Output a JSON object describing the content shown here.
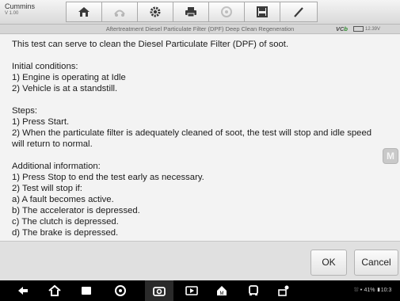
{
  "brand": {
    "name": "Cummins",
    "version": "V 1.00"
  },
  "toolbar": {
    "buttons": [
      {
        "icon": "home-icon"
      },
      {
        "icon": "vehicle-swap-icon"
      },
      {
        "icon": "settings-icon"
      },
      {
        "icon": "print-icon"
      },
      {
        "icon": "help-icon"
      },
      {
        "icon": "save-icon"
      },
      {
        "icon": "pen-icon"
      }
    ]
  },
  "titlebar": {
    "title": "Aftertreatment Diesel Particulate Filter (DPF) Deep Clean Regeneration",
    "vci_prefix": "VC",
    "vci_suffix": "b",
    "battery": "12.39V"
  },
  "content": {
    "intro": "This test can serve to clean the Diesel Particulate Filter (DPF) of soot.",
    "initial_heading": "Initial conditions:",
    "initial": [
      "1) Engine is operating at Idle",
      "2) Vehicle is at a standstill."
    ],
    "steps_heading": "Steps:",
    "steps": [
      "1) Press Start.",
      "2) When the particulate filter is adequately cleaned of soot, the test will stop and idle speed will return to normal."
    ],
    "additional_heading": "Additional information:",
    "additional": [
      "1) Press Stop to end the test early as necessary.",
      "2) Test will stop if:",
      "a) A fault becomes active.",
      "b) The accelerator is depressed.",
      "c) The clutch is depressed.",
      "d) The brake is depressed."
    ],
    "side_button": "M"
  },
  "actions": {
    "ok": "OK",
    "cancel": "Cancel"
  },
  "statusbar": {
    "battery_percent": "41%",
    "time": "10:3"
  }
}
